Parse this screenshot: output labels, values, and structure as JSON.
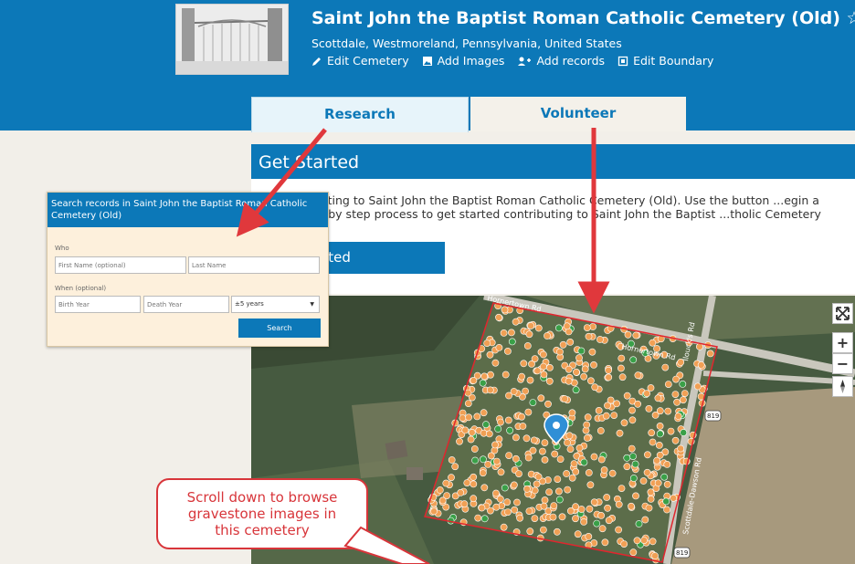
{
  "header": {
    "title": "Saint John the Baptist Roman Catholic Cemetery (Old)",
    "location": "Scottdale, Westmoreland, Pennsylvania, United States",
    "actions": [
      {
        "label": "Edit Cemetery",
        "icon": "pencil-icon"
      },
      {
        "label": "Add Images",
        "icon": "image-icon"
      },
      {
        "label": "Add records",
        "icon": "add-records-icon"
      },
      {
        "label": "Edit Boundary",
        "icon": "boundary-icon"
      }
    ],
    "favorite_icon": "star-outline-icon"
  },
  "tabs": [
    {
      "label": "Research",
      "active": false
    },
    {
      "label": "Volunteer",
      "active": true
    }
  ],
  "get_started": {
    "title": "Get Started",
    "text": "...d contributing to Saint John the Baptist Roman Catholic Cemetery (Old). Use the button ...egin a simple step by step process to get started contributing to Saint John the Baptist ...tholic Cemetery (Old).",
    "button": "Get Started"
  },
  "map": {
    "road_labels": [
      "Hornertown Rd",
      "Hornertown Rd",
      "Ilouck's Rd",
      "Scottdale-Dawson Rd"
    ],
    "route_shields": [
      "819",
      "819"
    ],
    "controls": {
      "fullscreen_icon": "fullscreen-icon",
      "zoom_in": "+",
      "zoom_out": "−",
      "north_icon": "compass-icon"
    },
    "colors": {
      "gravestone": "#f0a055",
      "photo": "#3aa048",
      "boundary": "#e0262e"
    }
  },
  "search_popup": {
    "title": "Search records in Saint John the Baptist Roman Catholic Cemetery (Old)",
    "who_label": "Who",
    "first_name_placeholder": "First Name (optional)",
    "last_name_placeholder": "Last Name",
    "when_label": "When (optional)",
    "birth_year_placeholder": "Birth Year",
    "death_year_placeholder": "Death Year",
    "range_value": "±5 years",
    "search_button": "Search"
  },
  "callout": {
    "lines": [
      "Scroll down to browse",
      "gravestone images in",
      "this cemetery"
    ]
  },
  "colors": {
    "primary": "#0c78b8",
    "arrow": "#e0383c"
  }
}
